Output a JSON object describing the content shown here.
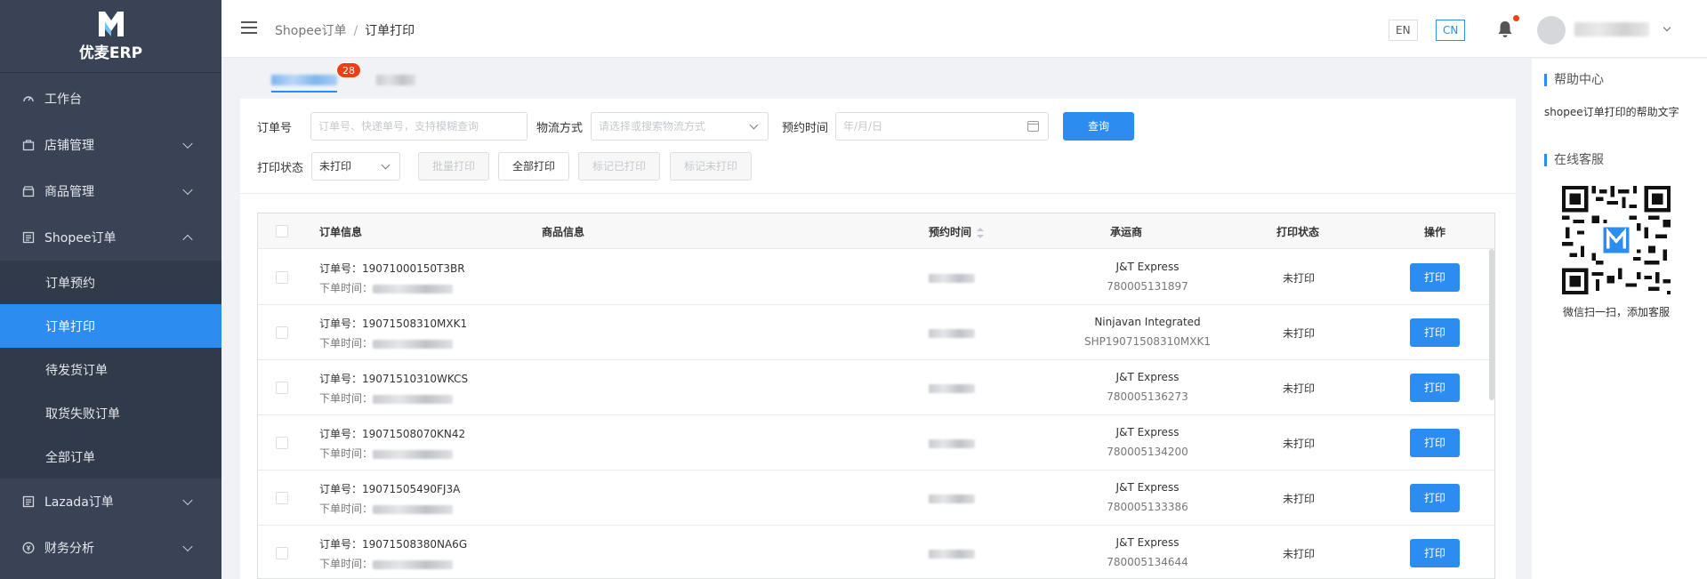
{
  "app": {
    "name": "优麦ERP"
  },
  "sidebar": {
    "items": [
      {
        "label": "工作台",
        "icon": "dashboard-icon"
      },
      {
        "label": "店铺管理",
        "icon": "store-icon"
      },
      {
        "label": "商品管理",
        "icon": "product-icon"
      },
      {
        "label": "Shopee订单",
        "icon": "order-icon"
      },
      {
        "label": "Lazada订单",
        "icon": "order-icon"
      },
      {
        "label": "财务分析",
        "icon": "finance-icon"
      }
    ],
    "shopee_sub": [
      {
        "label": "订单预约"
      },
      {
        "label": "订单打印"
      },
      {
        "label": "待发货订单"
      },
      {
        "label": "取货失败订单"
      },
      {
        "label": "全部订单"
      }
    ]
  },
  "header": {
    "breadcrumb": {
      "parent": "Shopee订单",
      "separator": "/",
      "current": "订单打印"
    },
    "lang_en": "EN",
    "lang_cn": "CN"
  },
  "tabs": {
    "badge": "28"
  },
  "filters": {
    "order_no_label": "订单号",
    "order_no_placeholder": "订单号、快递单号，支持模糊查询",
    "logistics_label": "物流方式",
    "logistics_placeholder": "请选择或搜索物流方式",
    "time_label": "预约时间",
    "date_placeholder": "年/月/日",
    "query_button": "查询",
    "print_status_label": "打印状态",
    "print_status_value": "未打印",
    "batch_print": "批量打印",
    "print_all": "全部打印",
    "mark_printed": "标记已打印",
    "mark_unprinted": "标记未打印"
  },
  "table": {
    "columns": [
      "订单信息",
      "商品信息",
      "预约时间",
      "承运商",
      "打印状态",
      "操作"
    ],
    "order_prefix": "订单号：",
    "time_prefix": "下单时间：",
    "rows": [
      {
        "order": "19071000150T3BR",
        "carrier": "J&T Express",
        "tracking": "780005131897",
        "status": "未打印",
        "action": "打印"
      },
      {
        "order": "19071508310MXK1",
        "carrier": "Ninjavan Integrated",
        "tracking": "SHP19071508310MXK1",
        "status": "未打印",
        "action": "打印"
      },
      {
        "order": "19071510310WKCS",
        "carrier": "J&T Express",
        "tracking": "780005136273",
        "status": "未打印",
        "action": "打印"
      },
      {
        "order": "19071508070KN42",
        "carrier": "J&T Express",
        "tracking": "780005134200",
        "status": "未打印",
        "action": "打印"
      },
      {
        "order": "19071505490FJ3A",
        "carrier": "J&T Express",
        "tracking": "780005133386",
        "status": "未打印",
        "action": "打印"
      },
      {
        "order": "19071508380NA6G",
        "carrier": "J&T Express",
        "tracking": "780005134644",
        "status": "未打印",
        "action": "打印"
      }
    ]
  },
  "help": {
    "title": "帮助中心",
    "text": "shopee订单打印的帮助文字",
    "service_title": "在线客服",
    "qr_caption": "微信扫一扫，添加客服"
  },
  "colors": {
    "accent": "#2d8cf0",
    "sidebar": "#3a4355",
    "badge": "#ed4014"
  }
}
